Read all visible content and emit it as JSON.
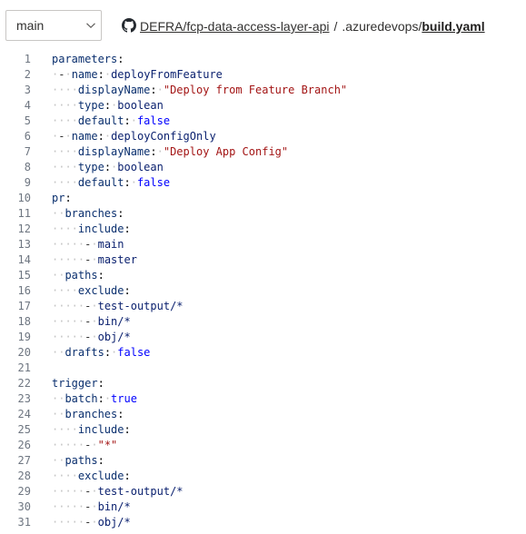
{
  "branch_selector": {
    "label": "main"
  },
  "breadcrumb": {
    "repo": "DEFRA/fcp-data-access-layer-api",
    "separator": "/",
    "folder": ".azuredevops",
    "file": "build.yaml"
  },
  "code_lines": [
    {
      "n": "1",
      "indent": 0,
      "dash": false,
      "key": "parameters",
      "value": "",
      "vtype": ""
    },
    {
      "n": "2",
      "indent": 1,
      "dash": true,
      "key": "name",
      "value": "deployFromFeature",
      "vtype": "plain"
    },
    {
      "n": "3",
      "indent": 2,
      "dash": false,
      "key": "displayName",
      "value": "\"Deploy from Feature Branch\"",
      "vtype": "str"
    },
    {
      "n": "4",
      "indent": 2,
      "dash": false,
      "key": "type",
      "value": "boolean",
      "vtype": "plain"
    },
    {
      "n": "5",
      "indent": 2,
      "dash": false,
      "key": "default",
      "value": "false",
      "vtype": "bool"
    },
    {
      "n": "6",
      "indent": 1,
      "dash": true,
      "key": "name",
      "value": "deployConfigOnly",
      "vtype": "plain"
    },
    {
      "n": "7",
      "indent": 2,
      "dash": false,
      "key": "displayName",
      "value": "\"Deploy App Config\"",
      "vtype": "str"
    },
    {
      "n": "8",
      "indent": 2,
      "dash": false,
      "key": "type",
      "value": "boolean",
      "vtype": "plain"
    },
    {
      "n": "9",
      "indent": 2,
      "dash": false,
      "key": "default",
      "value": "false",
      "vtype": "bool"
    },
    {
      "n": "10",
      "indent": 0,
      "dash": false,
      "key": "pr",
      "value": "",
      "vtype": ""
    },
    {
      "n": "11",
      "indent": 1,
      "dash": false,
      "key": "branches",
      "value": "",
      "vtype": ""
    },
    {
      "n": "12",
      "indent": 2,
      "dash": false,
      "key": "include",
      "value": "",
      "vtype": ""
    },
    {
      "n": "13",
      "indent": 3,
      "dash": true,
      "key": "",
      "value": "main",
      "vtype": "plain"
    },
    {
      "n": "14",
      "indent": 3,
      "dash": true,
      "key": "",
      "value": "master",
      "vtype": "plain"
    },
    {
      "n": "15",
      "indent": 1,
      "dash": false,
      "key": "paths",
      "value": "",
      "vtype": ""
    },
    {
      "n": "16",
      "indent": 2,
      "dash": false,
      "key": "exclude",
      "value": "",
      "vtype": ""
    },
    {
      "n": "17",
      "indent": 3,
      "dash": true,
      "key": "",
      "value": "test-output/*",
      "vtype": "plain"
    },
    {
      "n": "18",
      "indent": 3,
      "dash": true,
      "key": "",
      "value": "bin/*",
      "vtype": "plain"
    },
    {
      "n": "19",
      "indent": 3,
      "dash": true,
      "key": "",
      "value": "obj/*",
      "vtype": "plain"
    },
    {
      "n": "20",
      "indent": 1,
      "dash": false,
      "key": "drafts",
      "value": "false",
      "vtype": "bool"
    },
    {
      "n": "21",
      "indent": 0,
      "dash": false,
      "key": "",
      "value": "",
      "vtype": ""
    },
    {
      "n": "22",
      "indent": 0,
      "dash": false,
      "key": "trigger",
      "value": "",
      "vtype": ""
    },
    {
      "n": "23",
      "indent": 1,
      "dash": false,
      "key": "batch",
      "value": "true",
      "vtype": "bool"
    },
    {
      "n": "24",
      "indent": 1,
      "dash": false,
      "key": "branches",
      "value": "",
      "vtype": ""
    },
    {
      "n": "25",
      "indent": 2,
      "dash": false,
      "key": "include",
      "value": "",
      "vtype": ""
    },
    {
      "n": "26",
      "indent": 3,
      "dash": true,
      "key": "",
      "value": "\"*\"",
      "vtype": "str"
    },
    {
      "n": "27",
      "indent": 1,
      "dash": false,
      "key": "paths",
      "value": "",
      "vtype": ""
    },
    {
      "n": "28",
      "indent": 2,
      "dash": false,
      "key": "exclude",
      "value": "",
      "vtype": ""
    },
    {
      "n": "29",
      "indent": 3,
      "dash": true,
      "key": "",
      "value": "test-output/*",
      "vtype": "plain"
    },
    {
      "n": "30",
      "indent": 3,
      "dash": true,
      "key": "",
      "value": "bin/*",
      "vtype": "plain"
    },
    {
      "n": "31",
      "indent": 3,
      "dash": true,
      "key": "",
      "value": "obj/*",
      "vtype": "plain"
    }
  ]
}
